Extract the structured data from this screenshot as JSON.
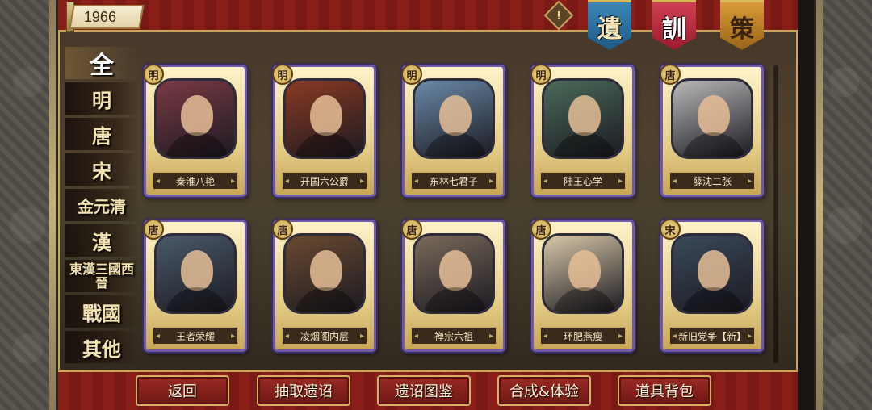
{
  "header": {
    "score": "1966",
    "info_symbol": "!",
    "banners": [
      "遺",
      "訓",
      "策"
    ]
  },
  "sidebar": {
    "dynasties": [
      "全",
      "明",
      "唐",
      "宋",
      "金元清",
      "漢",
      "東漢三國西晉",
      "戰國",
      "其他"
    ]
  },
  "cards": [
    {
      "dynasty": "明",
      "name": "秦淮八艳",
      "bg": "#7a3a44"
    },
    {
      "dynasty": "明",
      "name": "开国六公爵",
      "bg": "#8a3a22"
    },
    {
      "dynasty": "明",
      "name": "东林七君子",
      "bg": "#6a8aa8"
    },
    {
      "dynasty": "明",
      "name": "陆王心学",
      "bg": "#4a6a5a"
    },
    {
      "dynasty": "唐",
      "name": "薛沈二张",
      "bg": "#b8b8b8"
    },
    {
      "dynasty": "唐",
      "name": "王者荣耀",
      "bg": "#4a5a6a"
    },
    {
      "dynasty": "唐",
      "name": "凌烟阁内层",
      "bg": "#6a4a30"
    },
    {
      "dynasty": "唐",
      "name": "禅宗六祖",
      "bg": "#7a6a5a"
    },
    {
      "dynasty": "唐",
      "name": "环肥燕瘦",
      "bg": "#d8c8a8"
    },
    {
      "dynasty": "宋",
      "name": "新旧党争【新】",
      "bg": "#3a4a5a"
    }
  ],
  "buttons": {
    "back": "返回",
    "draw": "抽取遗诏",
    "gallery": "遗诏图鉴",
    "synthesize": "合成&体验",
    "bag": "道具背包"
  }
}
